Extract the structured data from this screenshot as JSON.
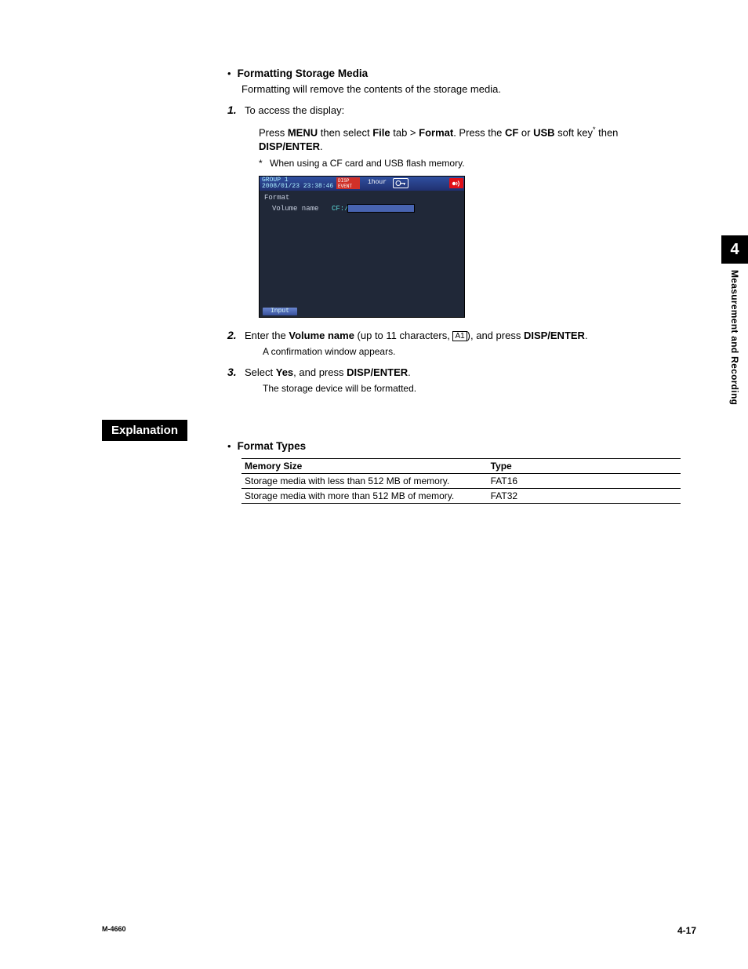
{
  "section1": {
    "title": "Formatting Storage Media",
    "desc": "Formatting will remove the contents of the storage media."
  },
  "step1": {
    "num": "1.",
    "text": "To access the display:",
    "sub_pre": "Press ",
    "menu": "MENU",
    "sub_mid1": " then select ",
    "file": "File",
    "sub_mid2": " tab > ",
    "format": "Format",
    "sub_mid3": ". Press the ",
    "cf": "CF",
    "or": " or ",
    "usb": "USB",
    "sub_post": " soft key",
    "then": " then ",
    "dispenter": "DISP/ENTER",
    "period": ".",
    "note_ast": "*",
    "note": "When using a CF card and USB flash memory."
  },
  "screenshot": {
    "group": "GROUP 1",
    "datetime": "2008/01/23 23:38:46",
    "disp1": "DISP",
    "disp2": "EVENT",
    "hour": "1hour",
    "format": "Format",
    "volname": "Volume name",
    "cf": "CF:/",
    "input": "Input"
  },
  "step2": {
    "num": "2.",
    "pre": "Enter the ",
    "volname": "Volume name",
    "mid": " (up to 11 characters, ",
    "a1": "A1",
    "post": "), and press ",
    "dispenter": "DISP/ENTER",
    "period": ".",
    "confirm": "A confirmation window appears."
  },
  "step3": {
    "num": "3.",
    "pre": "Select ",
    "yes": "Yes",
    "mid": ", and press ",
    "dispenter": "DISP/ENTER",
    "period": ".",
    "confirm": "The storage device will be formatted."
  },
  "explain": {
    "label": "Explanation",
    "title": "Format Types",
    "th1": "Memory Size",
    "th2": "Type",
    "r1c1": "Storage media with less than 512 MB of memory.",
    "r1c2": "FAT16",
    "r2c1": "Storage media with more than 512 MB of memory.",
    "r2c2": "FAT32"
  },
  "side": {
    "num": "4",
    "text": "Measurement and Recording"
  },
  "footer": {
    "left": "M-4660",
    "right": "4-17"
  }
}
